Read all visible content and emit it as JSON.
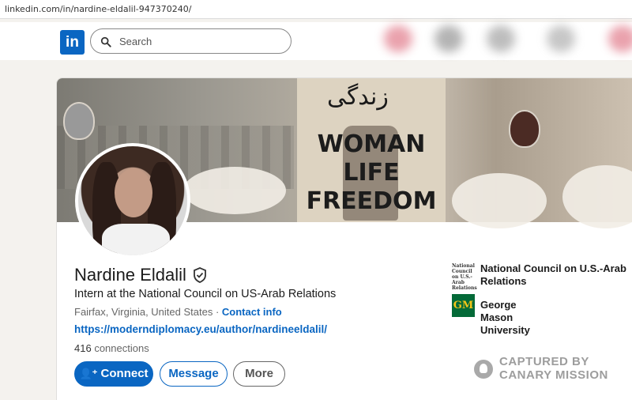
{
  "browser": {
    "url": "linkedin.com/in/nardine-eldalil-947370240/"
  },
  "nav": {
    "logo_text": "in",
    "search_placeholder": "Search",
    "search_icon": "search-icon"
  },
  "banner": {
    "script_text": "زندگی",
    "sign_lines": [
      "WOMAN",
      "LIFE",
      "FREEDOM"
    ]
  },
  "profile": {
    "name": "Nardine Eldalil",
    "verified_icon": "shield-check-icon",
    "headline": "Intern at the National Council on US-Arab Relations",
    "location": "Fairfax, Virginia, United States",
    "separator": " · ",
    "contact_info": "Contact info",
    "website": "https://moderndiplomacy.eu/author/nardineeldalil/",
    "connections_count": "416",
    "connections_label": " connections"
  },
  "actions": {
    "connect": "Connect",
    "connect_icon": "add-person-icon",
    "message": "Message",
    "more": "More"
  },
  "organizations": [
    {
      "name": "National Council on U.S.-Arab Relations",
      "logo_text": "National Council on U.S.-Arab Relations"
    },
    {
      "name": "George Mason University",
      "logo_text": "GM"
    }
  ],
  "watermark": {
    "line1": "CAPTURED BY",
    "line2": "CANARY MISSION"
  },
  "colors": {
    "brand": "#0a66c2",
    "page_bg": "#f4f2ee",
    "gmu_green": "#046a38"
  }
}
